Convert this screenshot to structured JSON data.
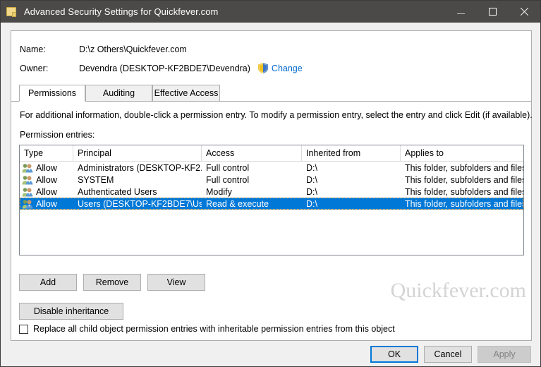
{
  "window": {
    "title": "Advanced Security Settings for Quickfever.com",
    "icon": "folder-icon",
    "minimize_label": "Minimize",
    "maximize_label": "Maximize",
    "close_label": "Close"
  },
  "header": {
    "name_label": "Name:",
    "name_value": "D:\\z Others\\Quickfever.com",
    "owner_label": "Owner:",
    "owner_value": "Devendra (DESKTOP-KF2BDE7\\Devendra)",
    "change_link": "Change",
    "shield_icon": "uac-shield-icon"
  },
  "tabs": [
    {
      "label": "Permissions",
      "active": true
    },
    {
      "label": "Auditing",
      "active": false
    },
    {
      "label": "Effective Access",
      "active": false
    }
  ],
  "body": {
    "info_text": "For additional information, double-click a permission entry. To modify a permission entry, select the entry and click Edit (if available).",
    "entries_label": "Permission entries:"
  },
  "table": {
    "columns": [
      "Type",
      "Principal",
      "Access",
      "Inherited from",
      "Applies to"
    ],
    "rows": [
      {
        "icon": "users-group-icon",
        "type": "Allow",
        "principal": "Administrators (DESKTOP-KF2...",
        "access": "Full control",
        "inherited_from": "D:\\",
        "applies_to": "This folder, subfolders and files",
        "selected": false
      },
      {
        "icon": "users-group-icon",
        "type": "Allow",
        "principal": "SYSTEM",
        "access": "Full control",
        "inherited_from": "D:\\",
        "applies_to": "This folder, subfolders and files",
        "selected": false
      },
      {
        "icon": "users-group-icon",
        "type": "Allow",
        "principal": "Authenticated Users",
        "access": "Modify",
        "inherited_from": "D:\\",
        "applies_to": "This folder, subfolders and files",
        "selected": false
      },
      {
        "icon": "users-group-icon",
        "type": "Allow",
        "principal": "Users (DESKTOP-KF2BDE7\\Us...",
        "access": "Read & execute",
        "inherited_from": "D:\\",
        "applies_to": "This folder, subfolders and files",
        "selected": true
      }
    ]
  },
  "actions": {
    "add": "Add",
    "remove": "Remove",
    "view": "View",
    "disable_inheritance": "Disable inheritance"
  },
  "checkbox": {
    "label": "Replace all child object permission entries with inheritable permission entries from this object",
    "checked": false
  },
  "footer": {
    "ok": "OK",
    "cancel": "Cancel",
    "apply": "Apply",
    "apply_disabled": true
  },
  "watermark": "Quickfever.com",
  "colors": {
    "titlebar": "#4c4a48",
    "selection": "#0078d7",
    "link": "#0066cc",
    "dialog_bg": "#f0f0f0",
    "focus_border": "#0078d7"
  }
}
